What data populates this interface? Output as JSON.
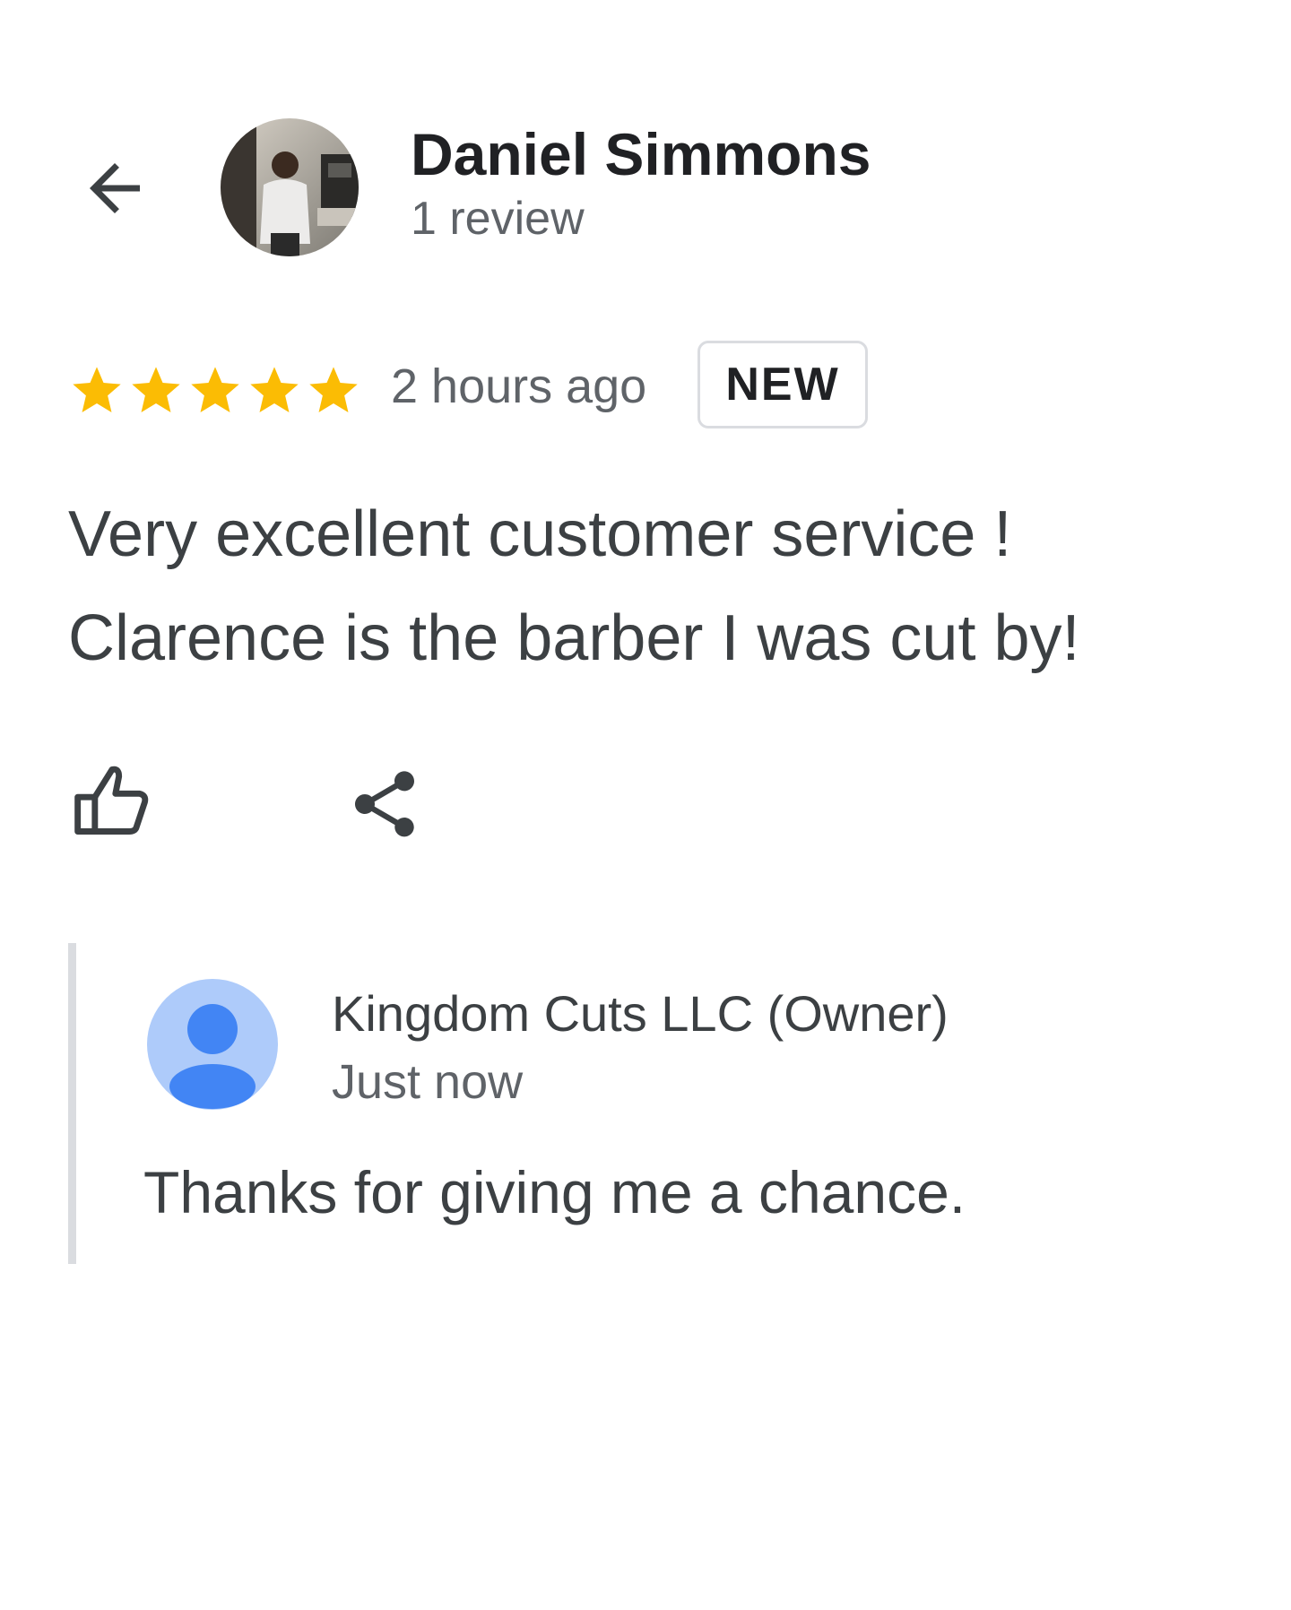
{
  "header": {
    "back_icon": "arrow-back-icon",
    "reviewer_name": "Daniel Simmons",
    "review_count": "1 review"
  },
  "rating": {
    "stars": 5,
    "max_stars": 5,
    "star_color": "#fbbc04",
    "time_ago": "2 hours ago",
    "badge": "NEW"
  },
  "review": {
    "line1": "Very excellent customer service !",
    "line2": "Clarence is the barber I was cut by!"
  },
  "actions": {
    "like_icon": "thumbs-up-icon",
    "share_icon": "share-icon"
  },
  "owner_reply": {
    "name": "Kingdom Cuts LLC (Owner)",
    "time": "Just now",
    "text": "Thanks for giving me a chance.",
    "avatar_icon": "person-icon",
    "avatar_bg": "#aecbfa",
    "avatar_fg": "#4285f4"
  }
}
